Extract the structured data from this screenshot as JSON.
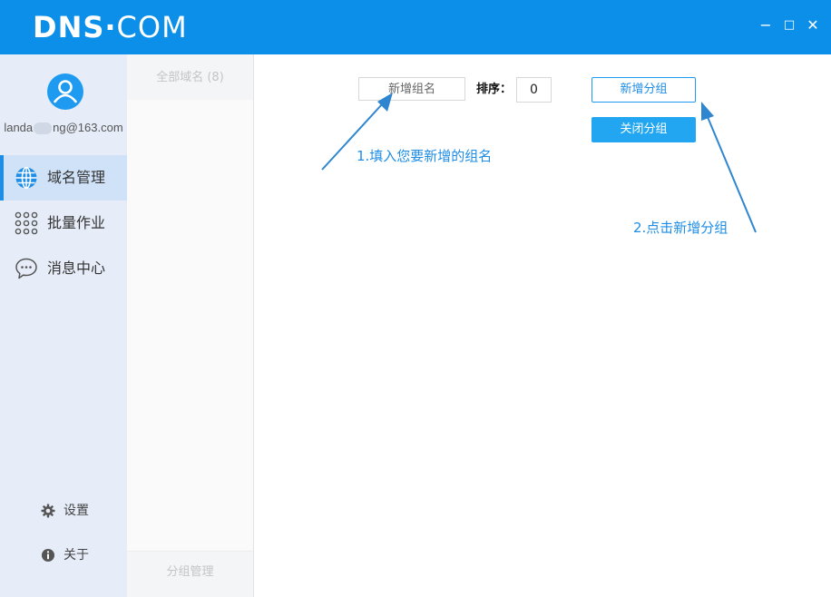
{
  "app": {
    "logo_main": "DNS",
    "logo_dot": "·",
    "logo_suffix": "COM",
    "window_controls": {
      "minimize": "−",
      "maximize": "□",
      "close": "✕"
    }
  },
  "user": {
    "email_prefix": "landa",
    "email_suffix": "ng@163.com"
  },
  "nav": {
    "domain_mgmt": "域名管理",
    "batch_ops": "批量作业",
    "messages": "消息中心"
  },
  "footer_nav": {
    "settings": "设置",
    "about": "关于"
  },
  "groups": {
    "all_domains": "全部域名 (8)",
    "group_manage": "分组管理"
  },
  "form": {
    "group_name_placeholder": "新增组名",
    "sort_label": "排序：",
    "sort_value": "0",
    "add_group_button": "新增分组",
    "close_group_button": "关闭分组"
  },
  "annotations": {
    "step1": "1.填入您要新增的组名",
    "step2": "2.点击新增分组"
  },
  "colors": {
    "titlebar": "#0b8fe8",
    "accent": "#1e8de6",
    "sidebar": "#e6edf8",
    "active_item": "#cfe2f7"
  }
}
